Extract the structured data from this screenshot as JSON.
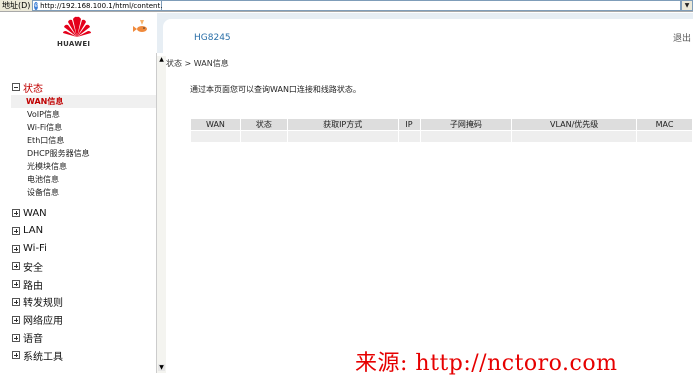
{
  "address_bar": {
    "label": "地址(D)",
    "url": "http://192.168.100.1/html/content.asp"
  },
  "brand": {
    "logo_text": "HUAWEI",
    "logo_color": "#e4001b"
  },
  "header": {
    "model": "HG8245",
    "logout_label": "退出"
  },
  "sidebar": {
    "groups": [
      {
        "label": "状态",
        "expanded": true,
        "items": [
          "WAN信息",
          "VoIP信息",
          "Wi-Fi信息",
          "Eth口信息",
          "DHCP服务器信息",
          "光模块信息",
          "电池信息",
          "设备信息"
        ],
        "active_item": "WAN信息"
      },
      {
        "label": "WAN",
        "expanded": false
      },
      {
        "label": "LAN",
        "expanded": false
      },
      {
        "label": "Wi-Fi",
        "expanded": false
      },
      {
        "label": "安全",
        "expanded": false
      },
      {
        "label": "路由",
        "expanded": false
      },
      {
        "label": "转发规则",
        "expanded": false
      },
      {
        "label": "网络应用",
        "expanded": false
      },
      {
        "label": "语音",
        "expanded": false
      },
      {
        "label": "系统工具",
        "expanded": false
      }
    ]
  },
  "main": {
    "breadcrumb": "状态 > WAN信息",
    "description": "通过本页面您可以查询WAN口连接和线路状态。",
    "table": {
      "columns": [
        "WAN",
        "状态",
        "获取IP方式",
        "IP",
        "子网掩码",
        "VLAN/优先级",
        "MAC"
      ],
      "rows": []
    }
  },
  "watermark": "来源: http://nctoro.com",
  "colors": {
    "accent_red": "#c00000",
    "header_bg": "#e7eef4",
    "model_blue": "#2a6fa8"
  }
}
